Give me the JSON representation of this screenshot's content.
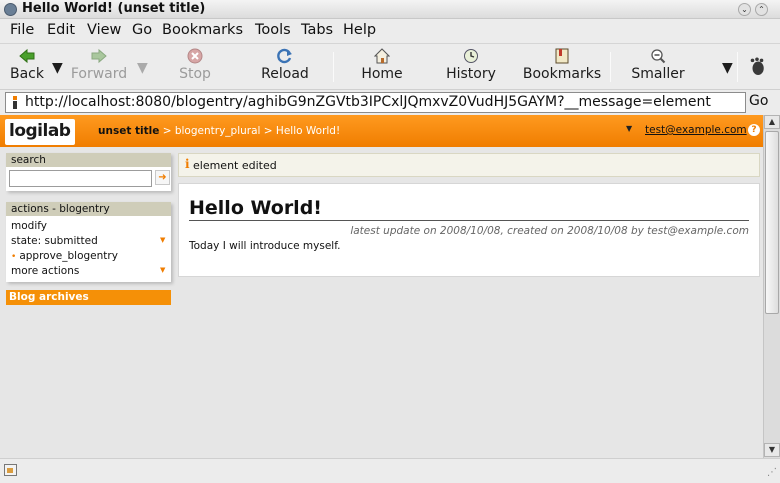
{
  "window": {
    "title": "Hello World! (unset title)"
  },
  "menu": [
    "File",
    "Edit",
    "View",
    "Go",
    "Bookmarks",
    "Tools",
    "Tabs",
    "Help"
  ],
  "toolbar": {
    "back": "Back",
    "forward": "Forward",
    "stop": "Stop",
    "reload": "Reload",
    "home": "Home",
    "history": "History",
    "bookmarks": "Bookmarks",
    "smaller": "Smaller"
  },
  "url": {
    "value": "http://localhost:8080/blogentry/aghibG9nZGVtb3IPCxlJQmxvZ0VudHJ5GAYM?__message=element",
    "go": "Go"
  },
  "site": {
    "logo": "logilab",
    "breadcrumb": {
      "root": "unset title",
      "sep1": " > ",
      "level1": "blogentry_plural",
      "sep2": " > ",
      "current": "Hello World!"
    },
    "user": "test@example.com",
    "help": "?"
  },
  "sidebar": {
    "search": {
      "title": "search",
      "placeholder": ""
    },
    "actions": {
      "title": "actions - blogentry",
      "modify": "modify",
      "state": "state: submitted",
      "transition": "approve_blogentry",
      "more": "more actions"
    },
    "archives": "Blog archives"
  },
  "message": {
    "icon": "i",
    "text": "element edited"
  },
  "entry": {
    "title": "Hello World!",
    "meta": "latest update on 2008/10/08, created on 2008/10/08 by test@example.com",
    "body": "Today I will introduce myself."
  },
  "colors": {
    "accent": "#f07d00",
    "box_title": "#cfcdb9"
  }
}
